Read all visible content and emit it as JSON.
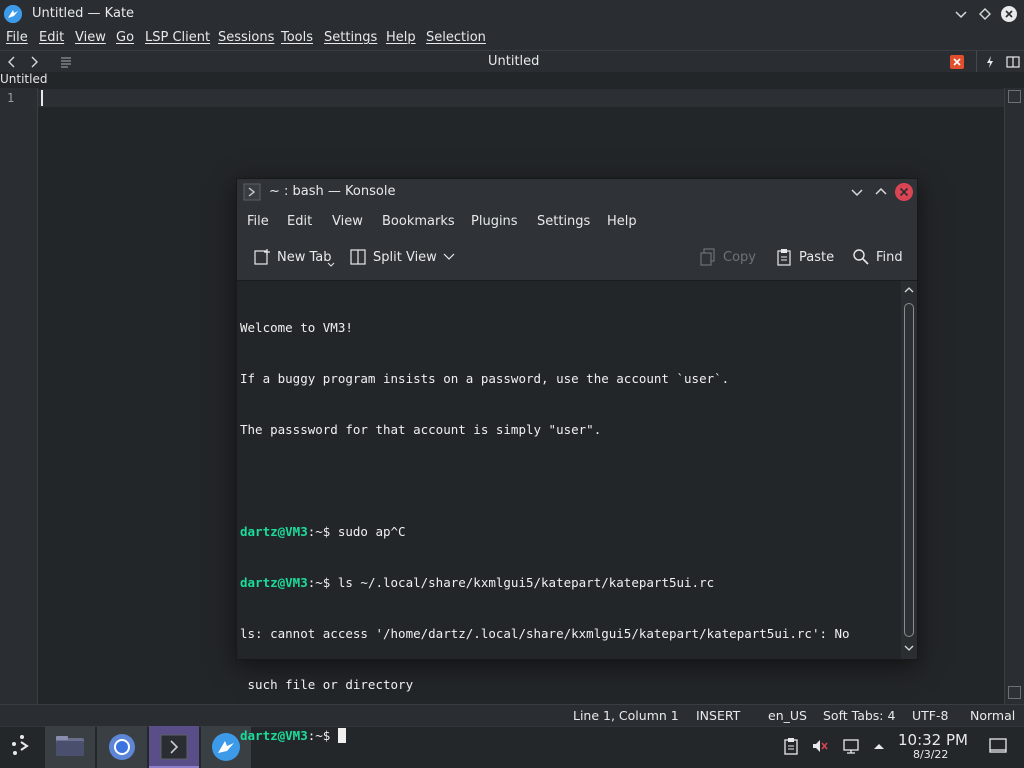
{
  "kate": {
    "title": "Untitled — Kate",
    "menu": [
      "File",
      "Edit",
      "View",
      "Go",
      "LSP Client",
      "Sessions",
      "Tools",
      "Settings",
      "Help",
      "Selection"
    ],
    "document_title": "Untitled",
    "tab_label": "Untitled",
    "line_number": "1"
  },
  "statusbar": {
    "position": "Line 1, Column 1",
    "mode": "INSERT",
    "language": "en_US",
    "indent": "Soft Tabs: 4",
    "encoding": "UTF-8",
    "highlight": "Normal"
  },
  "konsole": {
    "title": "~ : bash — Konsole",
    "menu": [
      "File",
      "Edit",
      "View",
      "Bookmarks",
      "Plugins",
      "Settings",
      "Help"
    ],
    "toolbar": {
      "new_tab": "New Tab",
      "split_view": "Split View",
      "copy": "Copy",
      "paste": "Paste",
      "find": "Find"
    },
    "terminal": {
      "line1": "Welcome to VM3!",
      "line2": "If a buggy program insists on a password, use the account `user`.",
      "line3": "The passsword for that account is simply \"user\".",
      "prompt_user": "dartz@VM3",
      "prompt_path": ":~$",
      "cmd1": " sudo ap^C",
      "cmd2": " ls ~/.local/share/kxmlgui5/katepart/katepart5ui.rc",
      "error1": "ls: cannot access '/home/dartz/.local/share/kxmlgui5/katepart/katepart5ui.rc': No",
      "error2": " such file or directory"
    }
  },
  "clock": {
    "time": "10:32 PM",
    "date": "8/3/22"
  },
  "colors": {
    "prompt": "#1cdc9a",
    "accent_purple": "#5a4e88",
    "close_red": "#da4453"
  }
}
